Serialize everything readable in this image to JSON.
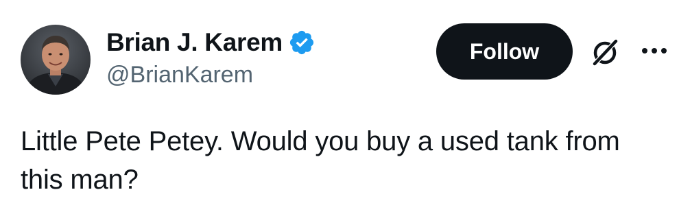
{
  "author": {
    "display_name": "Brian J. Karem",
    "handle": "@BrianKarem",
    "verified_icon": "verified-badge-icon"
  },
  "actions": {
    "follow_label": "Follow",
    "grok_icon": "grok-icon",
    "more_icon": "more-horizontal-icon"
  },
  "tweet": {
    "text": "Little Pete Petey. Would you buy a used tank from this man?"
  },
  "colors": {
    "text_primary": "#0f1419",
    "text_secondary": "#536471",
    "verified_blue": "#1d9bf0",
    "follow_bg": "#0f1419",
    "follow_text": "#ffffff"
  }
}
